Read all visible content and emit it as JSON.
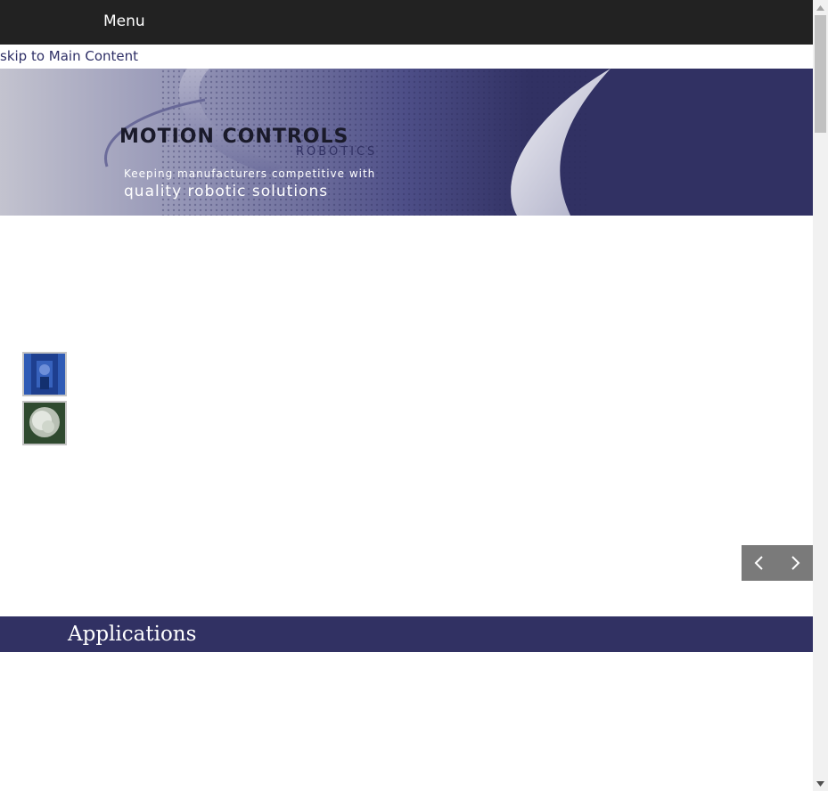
{
  "header": {
    "menu_label": "Menu"
  },
  "skip_link": {
    "label": "skip to Main Content"
  },
  "banner": {
    "brand_name": "MOTION CONTROLS",
    "brand_sub": "ROBOTICS",
    "tagline_line1": "Keeping manufacturers competitive with",
    "tagline_line2": "quality robotic solutions",
    "colors": {
      "navy": "#313163",
      "pattern": "#4a4b85"
    }
  },
  "slider": {
    "thumbnails": [
      "robot-cell-thumbnail",
      "material-closeup-thumbnail"
    ],
    "prev_icon": "chevron-left-icon",
    "next_icon": "chevron-right-icon"
  },
  "section": {
    "title": "Applications"
  },
  "colors": {
    "topbar": "#222222",
    "accent": "#313163",
    "link": "#2e2f66",
    "nav_bg": "#7a7a7a"
  }
}
